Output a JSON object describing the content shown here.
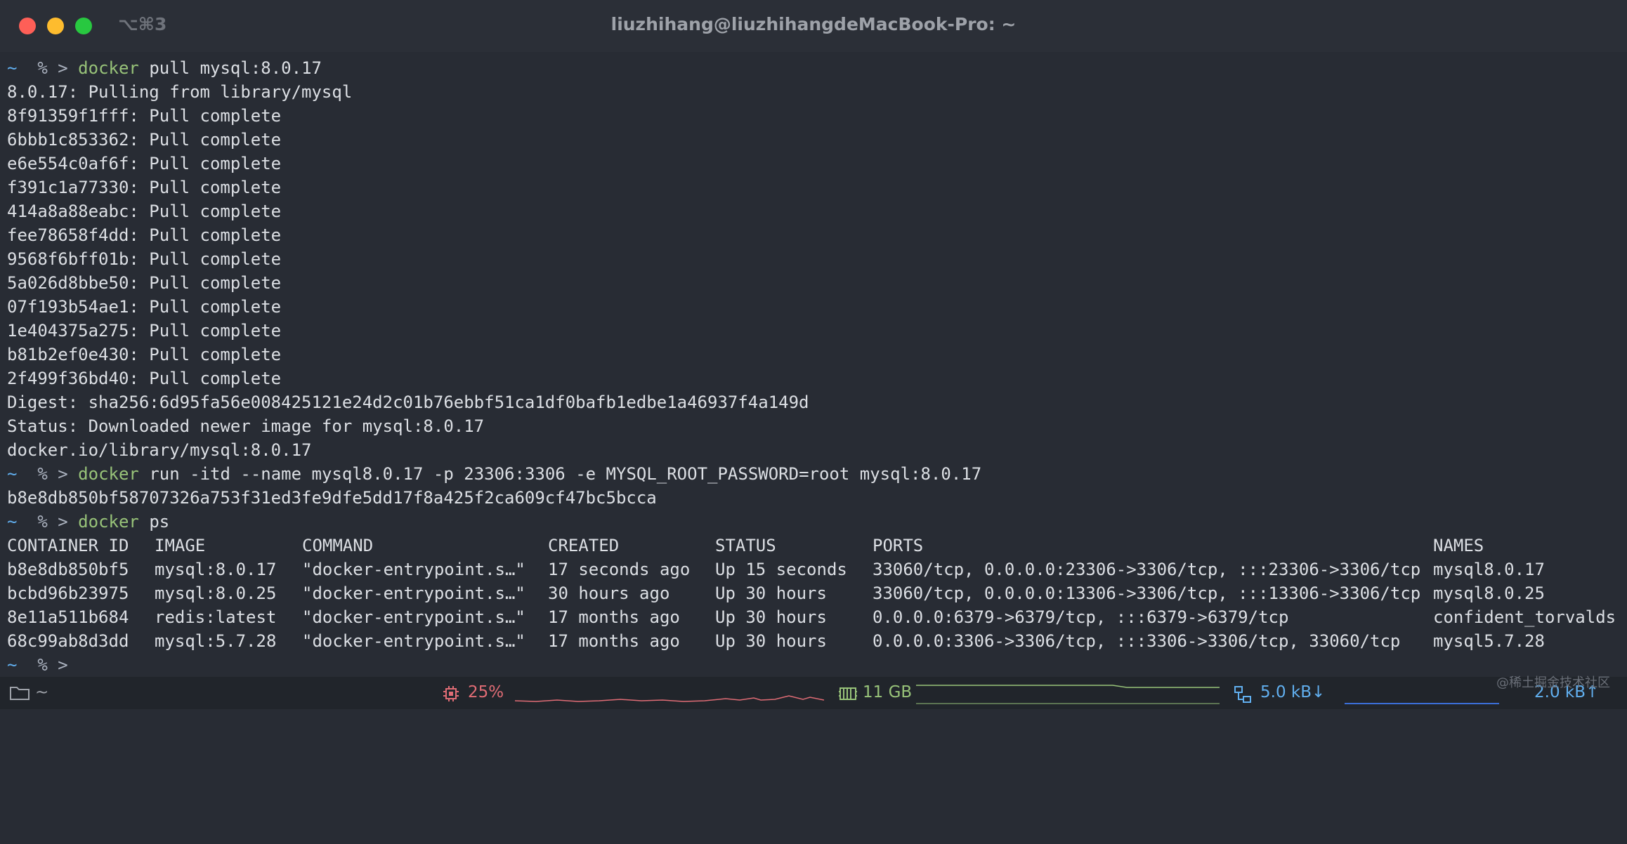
{
  "window": {
    "shortcut": "⌥⌘3",
    "title": "liuzhihang@liuzhihangdeMacBook-Pro: ~"
  },
  "terminal": {
    "prompt_tilde": "~",
    "prompt_symbol": "% >",
    "session1": {
      "cmd": "docker",
      "args": " pull mysql:8.0.17",
      "output": [
        "8.0.17: Pulling from library/mysql",
        "8f91359f1fff: Pull complete",
        "6bbb1c853362: Pull complete",
        "e6e554c0af6f: Pull complete",
        "f391c1a77330: Pull complete",
        "414a8a88eabc: Pull complete",
        "fee78658f4dd: Pull complete",
        "9568f6bff01b: Pull complete",
        "5a026d8bbe50: Pull complete",
        "07f193b54ae1: Pull complete",
        "1e404375a275: Pull complete",
        "b81b2ef0e430: Pull complete",
        "2f499f36bd40: Pull complete",
        "Digest: sha256:6d95fa56e008425121e24d2c01b76ebbf51ca1df0bafb1edbe1a46937f4a149d",
        "Status: Downloaded newer image for mysql:8.0.17",
        "docker.io/library/mysql:8.0.17"
      ]
    },
    "session2": {
      "cmd": "docker",
      "args": " run -itd --name mysql8.0.17 -p 23306:3306 -e MYSQL_ROOT_PASSWORD=root mysql:8.0.17",
      "output": "b8e8db850bf58707326a753f31ed3fe9dfe5dd17f8a425f2ca609cf47bc5bcca"
    },
    "session3": {
      "cmd": "docker",
      "args": " ps",
      "headers": [
        "CONTAINER ID",
        "IMAGE",
        "COMMAND",
        "CREATED",
        "STATUS",
        "PORTS",
        "NAMES"
      ],
      "rows": [
        [
          "b8e8db850bf5",
          "mysql:8.0.17",
          "\"docker-entrypoint.s…\"",
          "17 seconds ago",
          "Up 15 seconds",
          "33060/tcp, 0.0.0.0:23306->3306/tcp, :::23306->3306/tcp",
          "mysql8.0.17"
        ],
        [
          "bcbd96b23975",
          "mysql:8.0.25",
          "\"docker-entrypoint.s…\"",
          "30 hours ago",
          "Up 30 hours",
          "33060/tcp, 0.0.0.0:13306->3306/tcp, :::13306->3306/tcp",
          "mysql8.0.25"
        ],
        [
          "8e11a511b684",
          "redis:latest",
          "\"docker-entrypoint.s…\"",
          "17 months ago",
          "Up 30 hours",
          "0.0.0.0:6379->6379/tcp, :::6379->6379/tcp",
          "confident_torvalds"
        ],
        [
          "68c99ab8d3dd",
          "mysql:5.7.28",
          "\"docker-entrypoint.s…\"",
          "17 months ago",
          "Up 30 hours",
          "0.0.0.0:3306->3306/tcp, :::3306->3306/tcp, 33060/tcp",
          "mysql5.7.28"
        ]
      ]
    }
  },
  "statusbar": {
    "folder_label": "~",
    "cpu": "25%",
    "memory": "11 GB",
    "net_down": "5.0 kB↓",
    "net_up": "2.0 kB↑",
    "colors": {
      "cpu": "#e06c75",
      "memory": "#98c379",
      "network": "#61afef"
    }
  },
  "watermark": "@稀土掘金技术社区"
}
